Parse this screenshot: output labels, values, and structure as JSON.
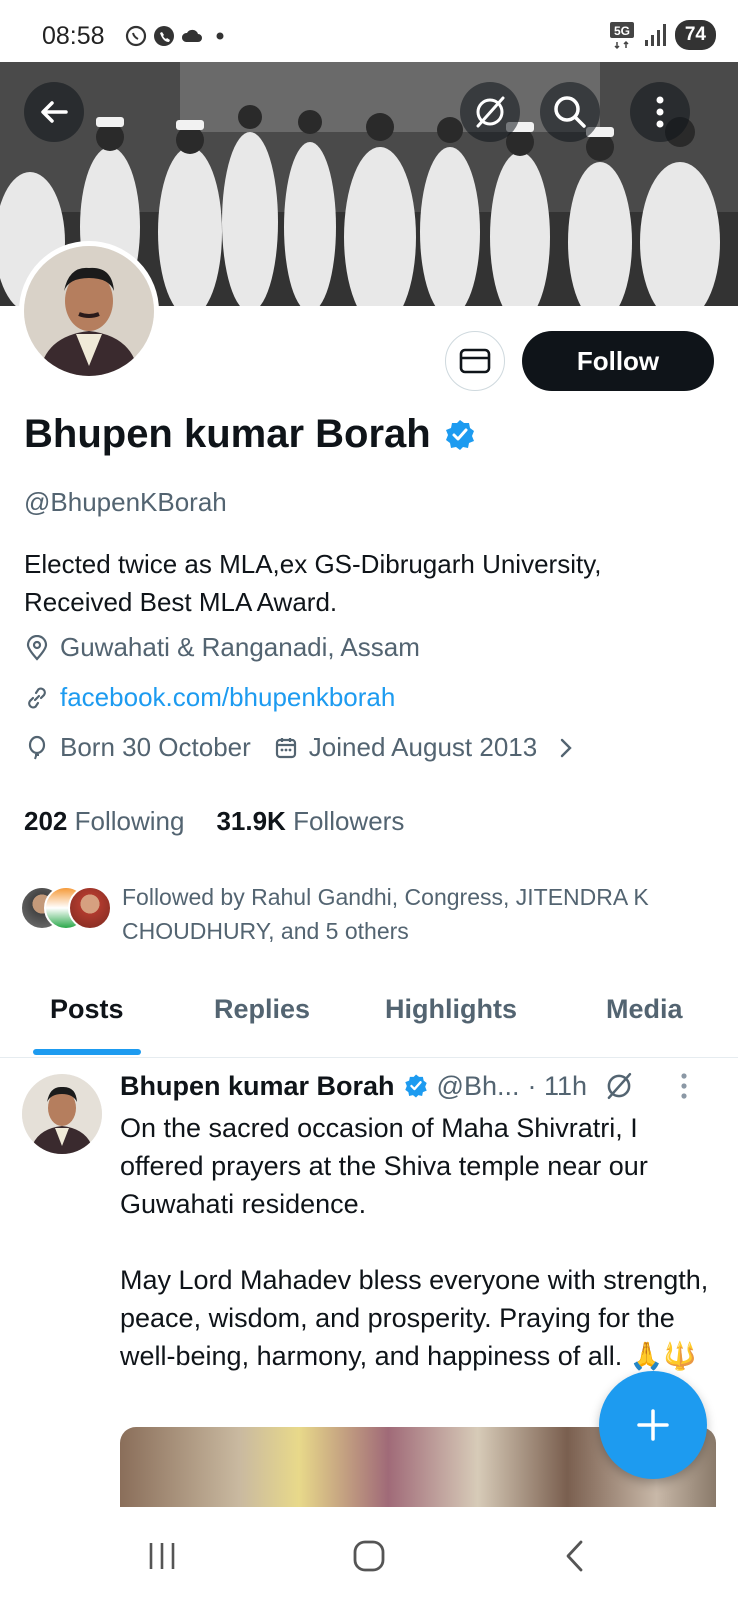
{
  "status_bar": {
    "time": "08:58",
    "network": "5G",
    "battery": "74",
    "left_icons": [
      "whatsapp-icon",
      "phone-icon",
      "cloud-icon",
      "dot-icon"
    ],
    "right_icons": [
      "5g-icon",
      "signal-icon",
      "battery-icon"
    ]
  },
  "banner": {
    "buttons": [
      "back-arrow-icon",
      "grok-icon",
      "search-icon",
      "more-vertical-icon"
    ]
  },
  "profile": {
    "name": "Bhupen kumar Borah",
    "verified": true,
    "handle": "@BhupenKBorah",
    "bio": "Elected twice as MLA,ex GS-Dibrugarh University, Received Best MLA Award.",
    "location": "Guwahati & Ranganadi, Assam",
    "website": "facebook.com/bhupenkborah",
    "born": "Born 30 October",
    "joined": "Joined August 2013",
    "following_count": "202",
    "following_label": "Following",
    "followers_count": "31.9K",
    "followers_label": "Followers",
    "followed_by": "Followed by Rahul Gandhi, Congress, JITENDRA K CHOUDHURY, and 5 others",
    "follow_label": "Follow"
  },
  "tabs": [
    {
      "label": "Posts",
      "active": true
    },
    {
      "label": "Replies",
      "active": false
    },
    {
      "label": "Highlights",
      "active": false
    },
    {
      "label": "Media",
      "active": false
    }
  ],
  "post": {
    "author": "Bhupen kumar Borah",
    "handle": "@Bh...",
    "time": "· 11h",
    "text": "On the sacred occasion of Maha Shivratri, I offered prayers at the Shiva temple near our Guwahati residence.\n\nMay Lord Mahadev bless everyone with strength, peace, wisdom, and prosperity. Praying for the well-being, harmony, and happiness of all. 🙏🔱"
  },
  "colors": {
    "accent": "#1d9bf0",
    "text": "#0f1419",
    "secondary_text": "#536471",
    "follow_button": "#0f1419"
  }
}
